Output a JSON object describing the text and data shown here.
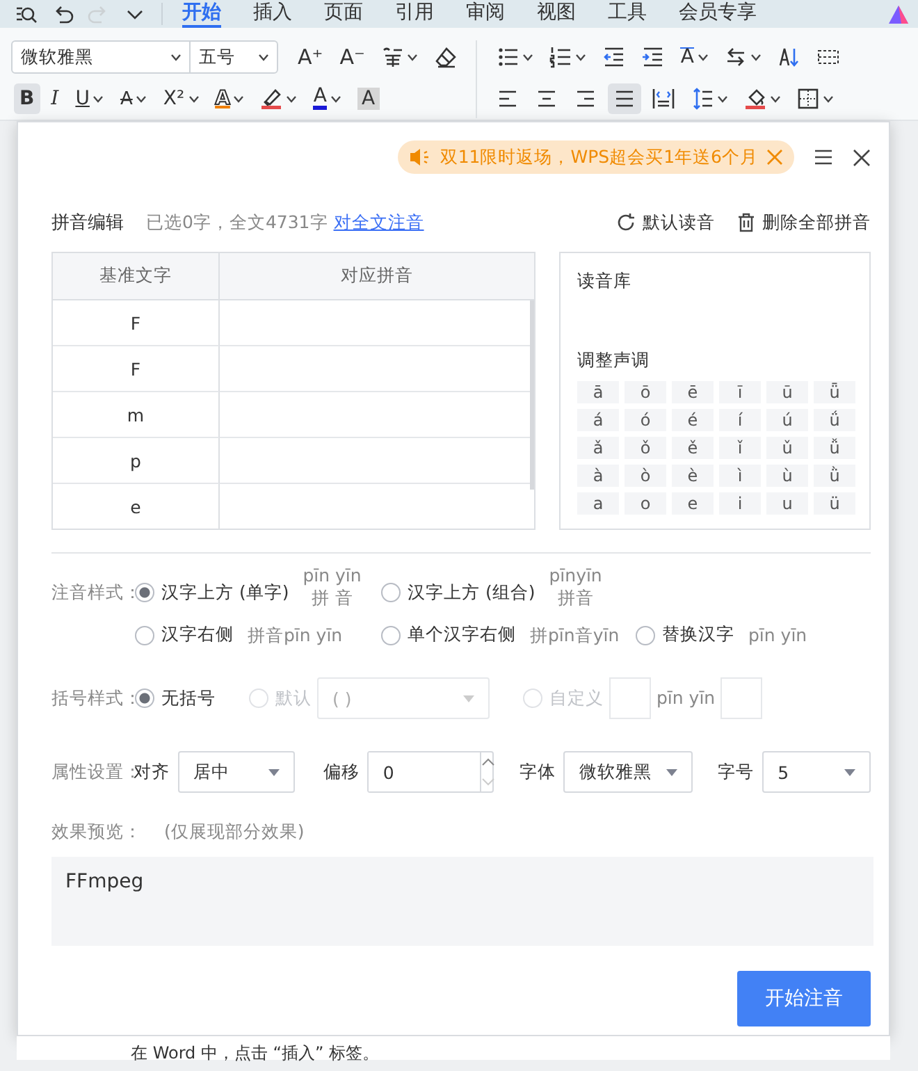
{
  "ribbon": {
    "quick_tools": [
      {
        "kind": "find",
        "disabled": false
      },
      {
        "kind": "undo",
        "disabled": false
      },
      {
        "kind": "redo",
        "disabled": true
      },
      {
        "kind": "more",
        "disabled": false
      }
    ],
    "tabs": [
      {
        "label": "开始",
        "selected": true
      },
      {
        "label": "插入",
        "selected": false
      },
      {
        "label": "页面",
        "selected": false
      },
      {
        "label": "引用",
        "selected": false
      },
      {
        "label": "审阅",
        "selected": false
      },
      {
        "label": "视图",
        "selected": false
      },
      {
        "label": "工具",
        "selected": false
      },
      {
        "label": "会员专享",
        "selected": false
      }
    ],
    "font": "微软雅黑",
    "size": "五号",
    "left_tools": [
      [
        {
          "kind": "grow",
          "glyph": "A⁺",
          "dropdown": false,
          "on": false
        },
        {
          "kind": "shrink",
          "glyph": "A⁻",
          "dropdown": false,
          "on": false
        },
        {
          "kind": "phonetic",
          "dropdown": true,
          "on": false
        },
        {
          "kind": "eraser",
          "dropdown": false,
          "on": false
        }
      ],
      [
        {
          "kind": "bold",
          "glyph": "B",
          "dropdown": false,
          "on": true
        },
        {
          "kind": "italic",
          "glyph": "I",
          "dropdown": false,
          "on": false
        },
        {
          "kind": "underline",
          "glyph": "U",
          "dropdown": true,
          "on": false
        },
        {
          "kind": "strike",
          "glyph": "A",
          "dropdown": true,
          "on": false
        },
        {
          "kind": "superscript",
          "glyph": "X²",
          "dropdown": true,
          "on": false
        },
        {
          "kind": "effect",
          "glyph": "A",
          "dropdown": true,
          "on": false
        },
        {
          "kind": "highlight",
          "dropdown": true,
          "on": false
        },
        {
          "kind": "color",
          "glyph": "A",
          "dropdown": true,
          "on": false
        },
        {
          "kind": "shading",
          "glyph": "A",
          "dropdown": false,
          "on": false
        }
      ]
    ],
    "right_tools": [
      [
        {
          "kind": "bullets",
          "dropdown": true,
          "on": false
        },
        {
          "kind": "numbering",
          "dropdown": true,
          "on": false
        },
        {
          "kind": "outdent",
          "dropdown": false,
          "on": false
        },
        {
          "kind": "indent",
          "dropdown": false,
          "on": false
        },
        {
          "kind": "spacing",
          "glyph": "A",
          "dropdown": true,
          "on": false
        },
        {
          "kind": "direction",
          "dropdown": true,
          "on": false
        },
        {
          "kind": "sort",
          "dropdown": false,
          "on": false
        },
        {
          "kind": "table",
          "dropdown": false,
          "on": false
        }
      ],
      [
        {
          "kind": "align-left",
          "dropdown": false,
          "on": false
        },
        {
          "kind": "align-center",
          "dropdown": false,
          "on": false
        },
        {
          "kind": "align-right",
          "dropdown": false,
          "on": false
        },
        {
          "kind": "justify",
          "dropdown": false,
          "on": true
        },
        {
          "kind": "distribute",
          "dropdown": false,
          "on": false
        },
        {
          "kind": "line-spacing",
          "dropdown": true,
          "on": false
        },
        {
          "kind": "fill",
          "dropdown": true,
          "on": false
        },
        {
          "kind": "border",
          "dropdown": true,
          "on": false
        }
      ]
    ]
  },
  "dialog": {
    "promo": "双11限时返场，WPS超会买1年送6个月",
    "editor": {
      "title": "拼音编辑",
      "summary": "已选0字，全文4731字",
      "link": "对全文注音",
      "actions": [
        {
          "kind": "reset",
          "label": "默认读音"
        },
        {
          "kind": "delete",
          "label": "删除全部拼音"
        }
      ]
    },
    "table": {
      "columns": [
        "基准文字",
        "对应拼音"
      ],
      "rows": [
        "F",
        "F",
        "m",
        "p",
        "e"
      ]
    },
    "library": {
      "title": "读音库"
    },
    "tones": {
      "title": "调整声调",
      "rows": [
        [
          "ā",
          "ō",
          "ē",
          "ī",
          "ū",
          "ǖ"
        ],
        [
          "á",
          "ó",
          "é",
          "í",
          "ú",
          "ǘ"
        ],
        [
          "ǎ",
          "ǒ",
          "ě",
          "ǐ",
          "ǔ",
          "ǚ"
        ],
        [
          "à",
          "ò",
          "è",
          "ì",
          "ù",
          "ǜ"
        ],
        [
          "a",
          "o",
          "e",
          "i",
          "u",
          "ü"
        ]
      ]
    },
    "style": {
      "label": "注音样式：",
      "rows": [
        [
          {
            "label": "汉字上方 (单字)",
            "selected": true,
            "kind": "stacked",
            "sample": [
              "pīn yīn",
              "拼  音"
            ]
          },
          {
            "label": "汉字上方 (组合)",
            "selected": false,
            "kind": "stacked",
            "sample": [
              "pīnyīn",
              "拼音"
            ]
          }
        ],
        [
          {
            "label": "汉字右侧",
            "selected": false,
            "kind": "inline",
            "sample": [
              "拼音pīn yīn"
            ]
          },
          {
            "label": "单个汉字右侧",
            "selected": false,
            "kind": "inline",
            "sample": [
              "拼pīn音yīn"
            ]
          },
          {
            "label": "替换汉字",
            "selected": false,
            "kind": "inline",
            "sample": [
              "pīn yīn"
            ]
          }
        ]
      ]
    },
    "bracket": {
      "label": "括号样式：",
      "options": [
        {
          "kind": "plain",
          "label": "无括号",
          "selected": true,
          "disabled": false
        },
        {
          "kind": "select",
          "label": "默认",
          "selected": false,
          "disabled": true,
          "value": "( )"
        },
        {
          "kind": "custom",
          "label": "自定义",
          "selected": false,
          "disabled": true,
          "sample": "pīn yīn"
        }
      ]
    },
    "attributes": {
      "label": "属性设置：",
      "fields": [
        {
          "kind": "select",
          "label": "对齐",
          "value": "居中"
        },
        {
          "kind": "spin",
          "label": "偏移",
          "value": "0"
        },
        {
          "kind": "select",
          "label": "字体",
          "value": "微软雅黑"
        },
        {
          "kind": "select",
          "label": "字号",
          "value": "5"
        }
      ]
    },
    "preview": {
      "label": "效果预览：",
      "note": "(仅展现部分效果)",
      "text": "FFmpeg"
    },
    "start_button": "开始注音"
  },
  "document_text": "在 Word 中，点击 “插入” 标签。"
}
